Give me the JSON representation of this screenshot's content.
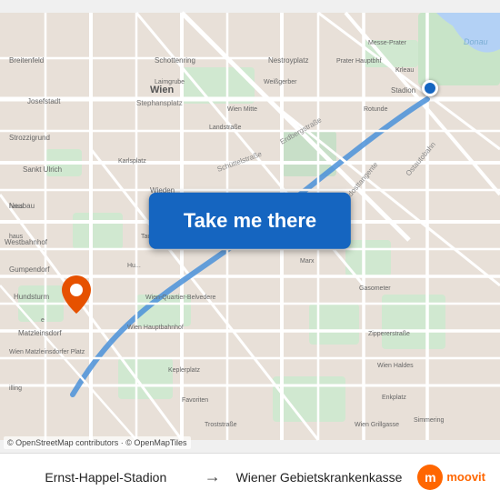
{
  "map": {
    "take_me_there_label": "Take me there",
    "attribution": "© OpenStreetMap contributors · © OpenMapTiles",
    "accent_color": "#1565C0",
    "route_color": "#4A90D9",
    "map_bg_color": "#e8e0d8",
    "road_color": "#ffffff",
    "water_color": "#b3d1f5",
    "green_color": "#c8dfc8",
    "origin_dot_color": "#1565C0",
    "destination_pin_color": "#e65100"
  },
  "bottom_bar": {
    "from_label": "Ernst-Happel-Stadion",
    "arrow": "→",
    "to_label": "Wiener Gebietskrankenkasse",
    "moovit_label": "moovit"
  }
}
